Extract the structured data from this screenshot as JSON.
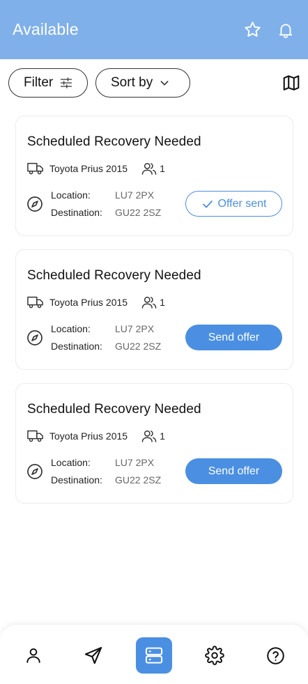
{
  "header": {
    "title": "Available",
    "icons": [
      "star-icon",
      "bell-icon"
    ]
  },
  "toolbar": {
    "filter_label": "Filter",
    "sort_label": "Sort by",
    "map_icon": "map-icon"
  },
  "labels": {
    "location": "Location:",
    "destination": "Destination:"
  },
  "jobs": [
    {
      "title": "Scheduled Recovery Needed",
      "vehicle": "Toyota Prius 2015",
      "passengers": "1",
      "location": "LU7 2PX",
      "destination": "GU22 2SZ",
      "action_label": "Offer sent",
      "action_state": "sent"
    },
    {
      "title": "Scheduled Recovery Needed",
      "vehicle": "Toyota Prius 2015",
      "passengers": "1",
      "location": "LU7 2PX",
      "destination": "GU22 2SZ",
      "action_label": "Send offer",
      "action_state": "send"
    },
    {
      "title": "Scheduled Recovery Needed",
      "vehicle": "Toyota Prius 2015",
      "passengers": "1",
      "location": "LU7 2PX",
      "destination": "GU22 2SZ",
      "action_label": "Send offer",
      "action_state": "send"
    }
  ],
  "nav": {
    "items": [
      "profile-icon",
      "send-icon",
      "jobs-icon",
      "settings-icon",
      "help-icon"
    ],
    "active": "jobs-icon"
  },
  "colors": {
    "header_bg": "#7fb0ea",
    "accent": "#4a8fe2"
  }
}
